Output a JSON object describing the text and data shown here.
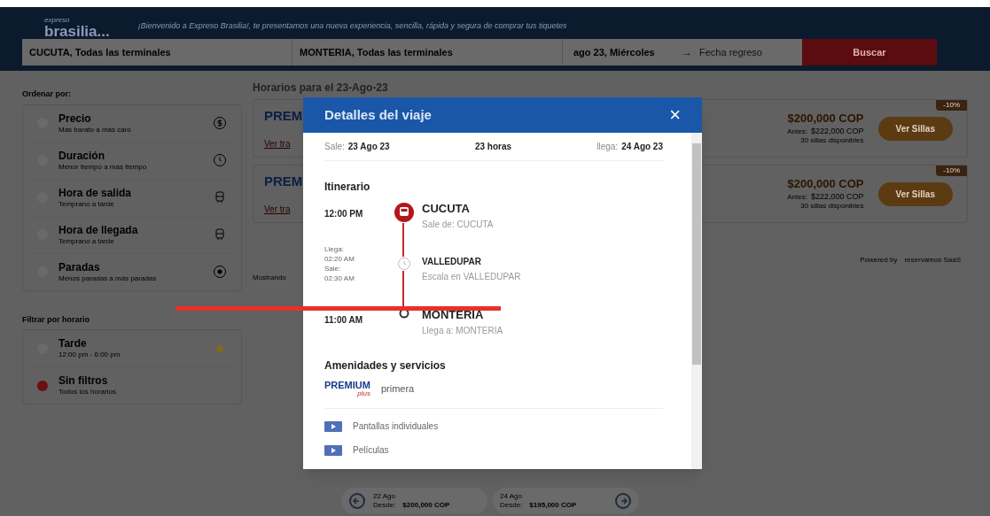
{
  "header": {
    "logo_top": "expreso",
    "logo": "brasilia...",
    "tagline": "¡Bienvenido a Expreso Brasilia!, te presentamos una nueva experiencia, sencilla, rápida y segura de comprar tus tiquetes"
  },
  "search": {
    "origin": "CUCUTA, Todas las terminales",
    "destination": "MONTERIA, Todas las terminales",
    "date": "ago 23, Miércoles",
    "arrow": "→",
    "return_placeholder": "Fecha regreso",
    "button": "Buscar"
  },
  "sort": {
    "title": "Ordenar por:",
    "items": [
      {
        "label": "Precio",
        "sub": "Más barato a más caro",
        "selected": false
      },
      {
        "label": "Duración",
        "sub": "Menor tiempo a más tiempo",
        "selected": false
      },
      {
        "label": "Hora de salida",
        "sub": "Temprano a tarde",
        "selected": false
      },
      {
        "label": "Hora de llegada",
        "sub": "Temprano a tarde",
        "selected": false
      },
      {
        "label": "Paradas",
        "sub": "Menos paradas a más paradas",
        "selected": false
      }
    ]
  },
  "filter": {
    "title": "Filtrar por horario",
    "items": [
      {
        "label": "Tarde",
        "sub": "12:00 pm - 6:00 pm",
        "selected": false
      },
      {
        "label": "Sin filtros",
        "sub": "Todos los horarios",
        "selected": true
      }
    ]
  },
  "results": {
    "title": "Horarios para el 23-Ago-23",
    "trips": [
      {
        "brand": "PREM",
        "link": "Ver tra",
        "price": "$200,000 COP",
        "before_label": "Antes:",
        "before": "$222,000 COP",
        "seats": "30 sillas disponibles",
        "discount": "-10%",
        "button": "Ver Sillas"
      },
      {
        "brand": "PREM",
        "link": "Ver tra",
        "price": "$200,000 COP",
        "before_label": "Antes:",
        "before": "$222,000 COP",
        "seats": "30 sillas disponibles",
        "discount": "-10%",
        "button": "Ver Sillas"
      }
    ],
    "note": "Mostrando",
    "powered": "Powered by",
    "powered_brand": "reservamos SaaS"
  },
  "dates": [
    {
      "day": "22 Ago",
      "from": "Desde:",
      "price": "$200,000 COP",
      "kind": "prev"
    },
    {
      "day": "24 Ago",
      "from": "Desde:",
      "price": "$195,000 COP",
      "kind": "next"
    }
  ],
  "modal": {
    "title": "Detalles del viaje",
    "close": "×",
    "depart_label": "Sale:",
    "depart": "23 Ago 23",
    "duration": "23 horas",
    "arrive_label": "llega:",
    "arrive": "24 Ago 23",
    "itinerary_title": "Itinerario",
    "stops": [
      {
        "kind": "origin",
        "time": "12:00 PM",
        "city": "CUCUTA",
        "detail": "Sale de: CUCUTA"
      },
      {
        "kind": "stopover",
        "arrive_label": "Llega:",
        "arrive_time": "02:20 AM",
        "leave_label": "Sale:",
        "leave_time": "02:30 AM",
        "city": "VALLEDUPAR",
        "detail": "Escala en VALLEDUPAR"
      },
      {
        "kind": "destination",
        "time": "11:00 AM",
        "city": "MONTERIA",
        "detail": "Llega a: MONTERIA"
      }
    ],
    "amenities_title": "Amenidades y servicios",
    "brand_top": "PREMIUM",
    "brand_script": "plus",
    "service": "primera",
    "amenities": [
      "Pantallas individuales",
      "Películas"
    ]
  }
}
